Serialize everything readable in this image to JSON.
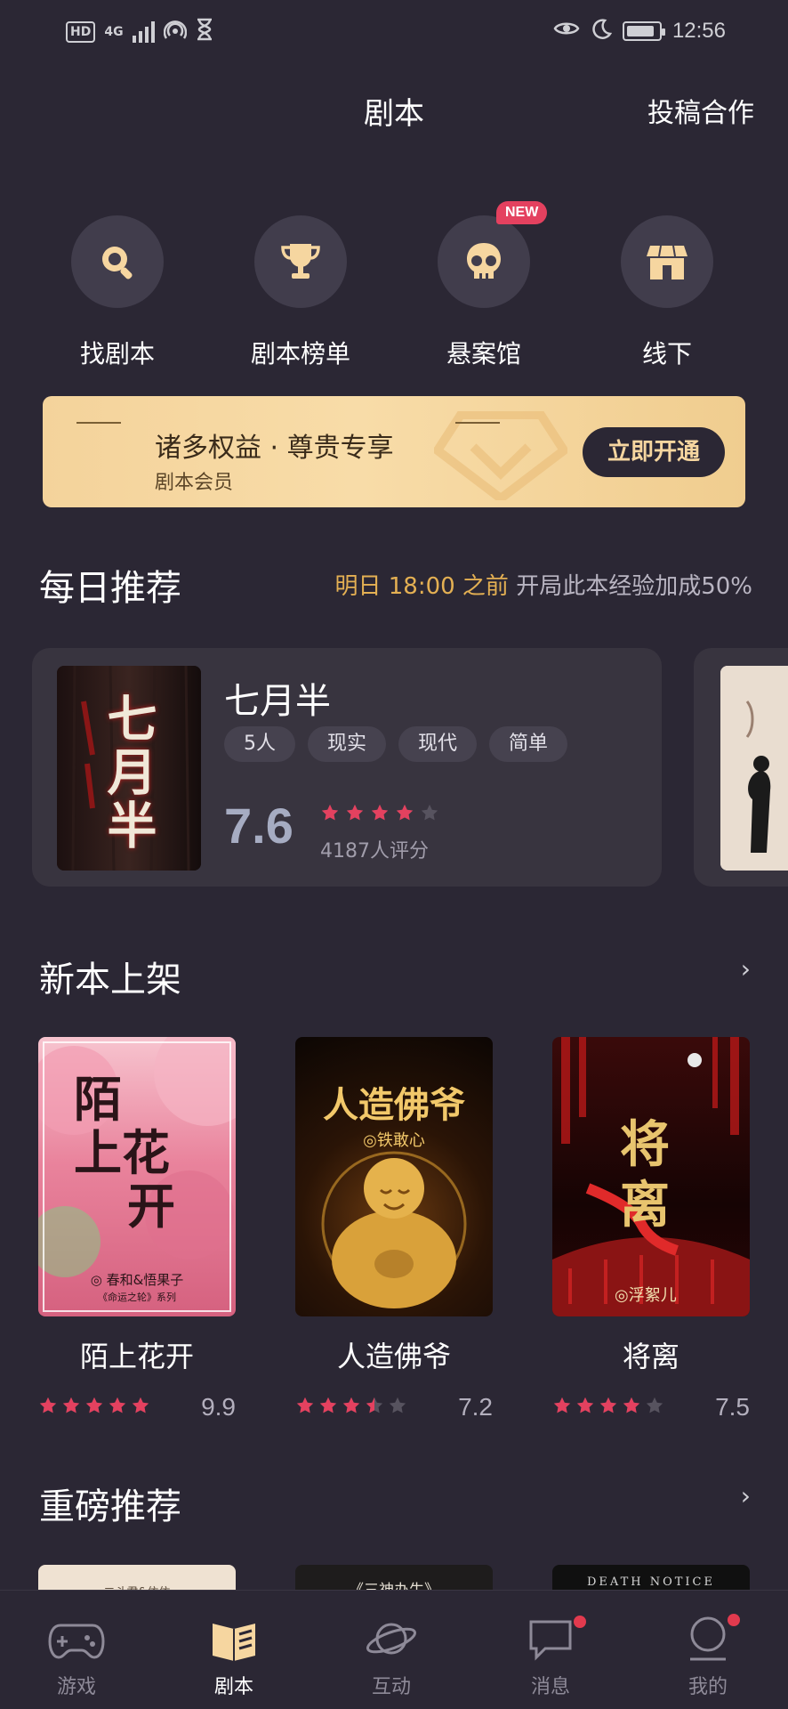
{
  "status_bar": {
    "time": "12:56",
    "hd": "HD",
    "network": "4G"
  },
  "header": {
    "title": "剧本",
    "action": "投稿合作"
  },
  "shortcuts": [
    {
      "label": "找剧本",
      "icon": "search-icon"
    },
    {
      "label": "剧本榜单",
      "icon": "trophy-icon"
    },
    {
      "label": "悬案馆",
      "icon": "skull-icon",
      "badge": "NEW"
    },
    {
      "label": "线下",
      "icon": "store-icon"
    }
  ],
  "member_banner": {
    "title": "诸多权益 · 尊贵专享",
    "subtitle": "剧本会员",
    "button": "立即开通"
  },
  "daily": {
    "section_title": "每日推荐",
    "note_highlight": "明日 18:00 之前",
    "note_rest": " 开局此本经验加成50%",
    "card": {
      "title": "七月半",
      "tags": [
        "5人",
        "现实",
        "现代",
        "简单"
      ],
      "score": "7.6",
      "stars": 4,
      "rating_count": "4187人评分",
      "cover_text": "七月半"
    }
  },
  "new_books": {
    "section_title": "新本上架",
    "chevron": "›",
    "items": [
      {
        "name": "陌上花开",
        "score": "9.9",
        "stars": 5,
        "cover_text": [
          "陌",
          "上花",
          "开"
        ],
        "cover_author": "◎ 春和&悟果子",
        "cover_series": "《命运之轮》系列"
      },
      {
        "name": "人造佛爷",
        "score": "7.2",
        "stars": 3.5,
        "cover_text": [
          "人造佛爷"
        ],
        "cover_author": "◎铁敢心"
      },
      {
        "name": "将离",
        "score": "7.5",
        "stars": 4,
        "cover_text": [
          "将",
          "离"
        ],
        "cover_author": "◎浮絮儿"
      }
    ]
  },
  "featured": {
    "section_title": "重磅推荐",
    "chevron": "›",
    "peeks": [
      "二斗君&依依",
      "《三神办生》",
      "DEATH NOTICE"
    ]
  },
  "bottom_nav": [
    {
      "label": "游戏",
      "icon": "game-icon",
      "active": false,
      "dot": false
    },
    {
      "label": "剧本",
      "icon": "book-icon",
      "active": true,
      "dot": false
    },
    {
      "label": "互动",
      "icon": "planet-icon",
      "active": false,
      "dot": false
    },
    {
      "label": "消息",
      "icon": "message-icon",
      "active": false,
      "dot": true
    },
    {
      "label": "我的",
      "icon": "profile-icon",
      "active": false,
      "dot": true
    }
  ],
  "colors": {
    "background": "#2b2734",
    "accent_gold": "#e4b053",
    "star_pink": "#e4415f",
    "card": "#38343f"
  }
}
